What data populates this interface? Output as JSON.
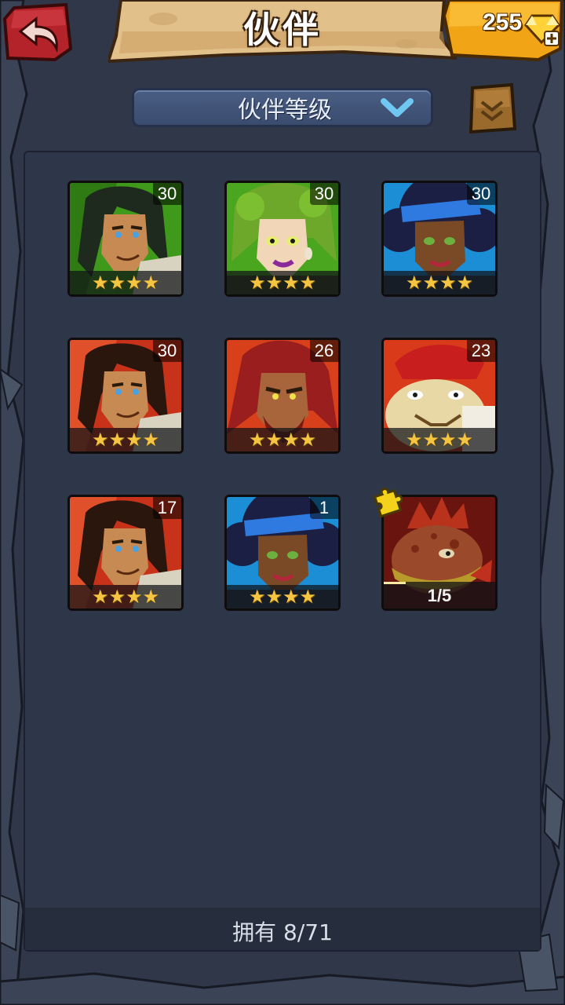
{
  "header": {
    "title": "伙伴",
    "gems": "255"
  },
  "sort": {
    "label": "伙伴等级"
  },
  "companions": [
    {
      "level": "30",
      "stars": "★★★★",
      "theme": "green",
      "character": "long-haired-hero"
    },
    {
      "level": "30",
      "stars": "★★★★",
      "theme": "green",
      "character": "leaf-haired-woman"
    },
    {
      "level": "30",
      "stars": "★★★★",
      "theme": "blue",
      "character": "afro-bandana-woman"
    },
    {
      "level": "30",
      "stars": "★★★★",
      "theme": "red",
      "character": "long-haired-hero"
    },
    {
      "level": "26",
      "stars": "★★★★",
      "theme": "red",
      "character": "red-haired-brute"
    },
    {
      "level": "23",
      "stars": "★★★★",
      "theme": "red",
      "character": "red-hat-beast"
    },
    {
      "level": "17",
      "stars": "★★★★",
      "theme": "red",
      "character": "long-haired-hero"
    },
    {
      "level": "1",
      "stars": "★★★★",
      "theme": "blue",
      "character": "afro-bandana-woman"
    }
  ],
  "locked_companion": {
    "shards": "1/5",
    "progress": 0.2,
    "character": "red-lizard-creature"
  },
  "footer": {
    "owned": "拥有 8/71"
  },
  "colors": {
    "background": "#2f3748",
    "gold": "#f5c542",
    "back_button": "#b5232a",
    "green_card": "#3f9a1c",
    "red_card": "#c8321a",
    "blue_card": "#1b8ed6"
  }
}
